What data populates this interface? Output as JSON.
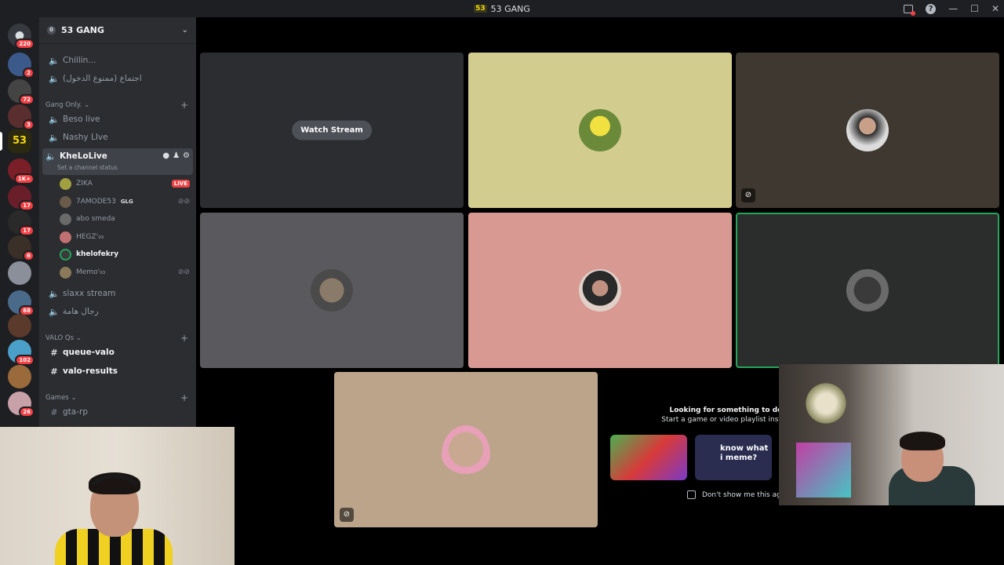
{
  "window": {
    "title": "53 GANG",
    "logo": "53"
  },
  "guilds": [
    {
      "badge": "220",
      "color": "#36393f",
      "active": false
    },
    {
      "badge": "2",
      "color": "#3b5a8a",
      "active": false
    },
    {
      "badge": "72",
      "color": "#444444",
      "active": false
    },
    {
      "badge": "3",
      "color": "#5a2e2e",
      "active": false
    },
    {
      "badge": "",
      "color": "#2b2a10",
      "active": true
    },
    {
      "badge": "1K+",
      "color": "#7a1e28",
      "active": false
    },
    {
      "badge": "17",
      "color": "#6a1e2a",
      "active": false
    },
    {
      "badge": "17",
      "color": "#2a2a2a",
      "active": false
    },
    {
      "badge": "6",
      "color": "#3a3028",
      "active": false
    },
    {
      "badge": "",
      "color": "#8a8f9a",
      "active": false
    },
    {
      "badge": "68",
      "color": "#4a6a8a",
      "active": false
    },
    {
      "badge": "",
      "color": "#5a3a2a",
      "active": false
    },
    {
      "badge": "102",
      "color": "#4aa0c8",
      "active": false
    },
    {
      "badge": "",
      "color": "#9a6a3a",
      "active": false
    },
    {
      "badge": "26",
      "color": "#c8a0a8",
      "active": false
    }
  ],
  "server": {
    "name": "53 GANG",
    "boost": "0"
  },
  "channels_top": [
    {
      "name": "Chillin..."
    },
    {
      "name": "اجتماع (ممنوع الدخول)"
    }
  ],
  "categories": {
    "gang": "Gang Only.",
    "valo": "VALO Qs",
    "games": "Games"
  },
  "gang_channels": [
    {
      "name": "Beso live"
    },
    {
      "name": "Nashy LIve"
    }
  ],
  "active_channel": {
    "name": "KheLoLive",
    "sub": "Set a channel status"
  },
  "users": [
    {
      "name": "ZIKA",
      "live": "LIVE",
      "tag": "",
      "color": "#a0a040"
    },
    {
      "name": "7AMODE53",
      "tag": "GLG",
      "color": "#6a5a4a"
    },
    {
      "name": "abo smeda",
      "tag": "",
      "color": "#6a6a6a"
    },
    {
      "name": "HEGZ'₉₃",
      "tag": "",
      "color": "#c07070"
    },
    {
      "name": "khelofekry",
      "tag": "",
      "color": "#3a3a3a"
    },
    {
      "name": "Memo'₉₃",
      "tag": "",
      "color": "#8a7a5a"
    }
  ],
  "more_channels": [
    {
      "name": "slaxx stream"
    },
    {
      "name": "رجال هامة"
    }
  ],
  "valo_channels": [
    {
      "name": "queue-valo"
    },
    {
      "name": "valo-results"
    }
  ],
  "games_channels": [
    {
      "name": "gta-rp"
    }
  ],
  "stage": {
    "watch_stream": "Watch Stream",
    "activity_line1": "Looking for something to do?",
    "activity_line2": "Start a game or video playlist instead",
    "dont_show": "Don't show me this again",
    "meme_card": "know what i meme?"
  },
  "tiles": [
    {
      "bg": "#2b2d31",
      "avatar": ""
    },
    {
      "bg": "#d2cc8f",
      "avatar": "#6a8a3a"
    },
    {
      "bg": "#3e3830",
      "avatar": "#8a6a5a"
    },
    {
      "bg": "#5a5a5e",
      "avatar": "#6a5a5a"
    },
    {
      "bg": "#d79992",
      "avatar": "#8a5a50"
    },
    {
      "bg": "#2b2d2c",
      "avatar": "#4a4a4a"
    },
    {
      "bg": "#bba48a",
      "avatar": "#e8a0b8"
    }
  ]
}
